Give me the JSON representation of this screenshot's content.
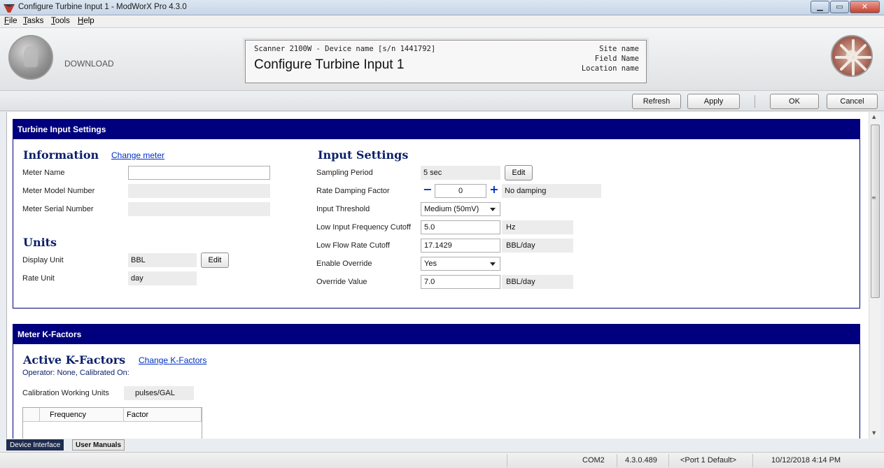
{
  "window": {
    "title": "Configure Turbine Input 1 - ModWorX Pro 4.3.0",
    "minimize": "▁",
    "maximize": "▭",
    "close": "✕"
  },
  "menu": [
    "File",
    "Tasks",
    "Tools",
    "Help"
  ],
  "header": {
    "download_label": "DOWNLOAD",
    "device_line": "Scanner 2100W - Device name [s/n 1441792]",
    "screen_title": "Configure Turbine Input 1",
    "site_name": "Site name",
    "field_name": "Field Name",
    "location_name": "Location name"
  },
  "actions": {
    "refresh": "Refresh",
    "apply": "Apply",
    "ok": "OK",
    "cancel": "Cancel"
  },
  "turbine_panel": {
    "title": "Turbine Input Settings",
    "information": {
      "heading": "Information",
      "change_meter_link": "Change meter",
      "meter_name_label": "Meter Name",
      "meter_name_value": "",
      "meter_model_label": "Meter Model Number",
      "meter_model_value": "",
      "meter_serial_label": "Meter Serial Number",
      "meter_serial_value": ""
    },
    "units": {
      "heading": "Units",
      "display_unit_label": "Display Unit",
      "display_unit_value": "BBL",
      "edit_label": "Edit",
      "rate_unit_label": "Rate Unit",
      "rate_unit_value": "day"
    },
    "input_settings": {
      "heading": "Input Settings",
      "sampling_period_label": "Sampling Period",
      "sampling_period_value": "5 sec",
      "edit_label": "Edit",
      "damping_label": "Rate Damping Factor",
      "damping_value": "0",
      "damping_minus": "−",
      "damping_plus": "+",
      "damping_text": "No damping",
      "threshold_label": "Input Threshold",
      "threshold_value": "Medium (50mV)",
      "low_freq_label": "Low Input Frequency Cutoff",
      "low_freq_value": "5.0",
      "low_freq_unit": "Hz",
      "low_flow_label": "Low Flow Rate Cutoff",
      "low_flow_value": "17.1429",
      "low_flow_unit": "BBL/day",
      "override_label": "Enable Override",
      "override_value": "Yes",
      "override_value_label": "Override Value",
      "override_value_value": "7.0",
      "override_value_unit": "BBL/day"
    }
  },
  "kfactor_panel": {
    "title": "Meter K-Factors",
    "heading": "Active K-Factors",
    "change_link": "Change K-Factors",
    "operator_text": "Operator: None, Calibrated On:",
    "cal_units_label": "Calibration Working Units",
    "cal_units_value": "pulses/GAL",
    "table_headers": [
      "Frequency",
      "Factor"
    ]
  },
  "bottom_tabs": {
    "device_interface": "Device Interface",
    "user_manuals": "User Manuals"
  },
  "status": {
    "port": "COM2",
    "version": "4.3.0.489",
    "port_default": "<Port 1 Default>",
    "datetime": "10/12/2018 4:14 PM"
  },
  "colors": {
    "panel_header": "#00007e",
    "link": "#0030c0",
    "section_heading": "#0b1f6b"
  }
}
